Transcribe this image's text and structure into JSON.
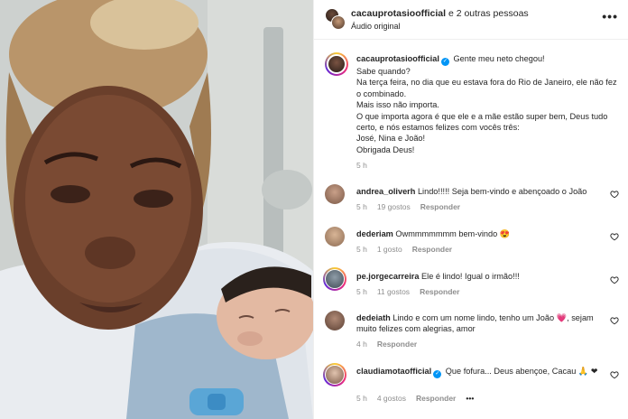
{
  "header": {
    "username": "cacauprotasioofficial",
    "others": " e 2 outras pessoas",
    "audio": "Áudio original",
    "more": "•••"
  },
  "caption": {
    "username": "cacauprotasioofficial",
    "lines": [
      "Gente meu neto chegou!",
      "Sabe quando?",
      "Na terça feira, no dia que eu estava fora do Rio de Janeiro, ele não fez o combinado.",
      "Mais isso não importa.",
      "O que importa agora é que ele e a mãe estão super bem, Deus tudo certo, e nós estamos felizes com vocês três:",
      "José, Nina e João!",
      "Obrigada Deus!"
    ],
    "time": "5 h"
  },
  "comments": [
    {
      "username": "andrea_oliverh",
      "text": "Lindo!!!!! Seja bem-vindo e abençoado o João",
      "time": "5 h",
      "likes": "19 gostos",
      "reply": "Responder",
      "verified": false,
      "extra": ""
    },
    {
      "username": "dederiam",
      "text": "Owmmmmmmm bem-vindo 😍",
      "time": "5 h",
      "likes": "1 gosto",
      "reply": "Responder",
      "verified": false,
      "extra": ""
    },
    {
      "username": "pe.jorgecarreira",
      "text": "Ele é lindo! Igual o irmão!!!",
      "time": "5 h",
      "likes": "11 gostos",
      "reply": "Responder",
      "verified": false,
      "extra": ""
    },
    {
      "username": "dedeiath",
      "text": "Lindo e com um nome lindo, tenho um João 💗, sejam muito felizes com alegrias, amor",
      "time": "4 h",
      "likes": "",
      "reply": "Responder",
      "verified": false,
      "extra": ""
    },
    {
      "username": "claudiamotaofficial",
      "text": "Que fofura... Deus abençoe, Cacau 🙏 ❤",
      "time": "5 h",
      "likes": "4 gostos",
      "reply": "Responder",
      "verified": true,
      "extra": "•••"
    }
  ],
  "colors": {
    "verified": "#0095f6",
    "muted": "#8e8e8e",
    "text": "#262626"
  },
  "icons": {
    "like": "heart-outline-icon",
    "verified": "verified-badge-icon"
  }
}
